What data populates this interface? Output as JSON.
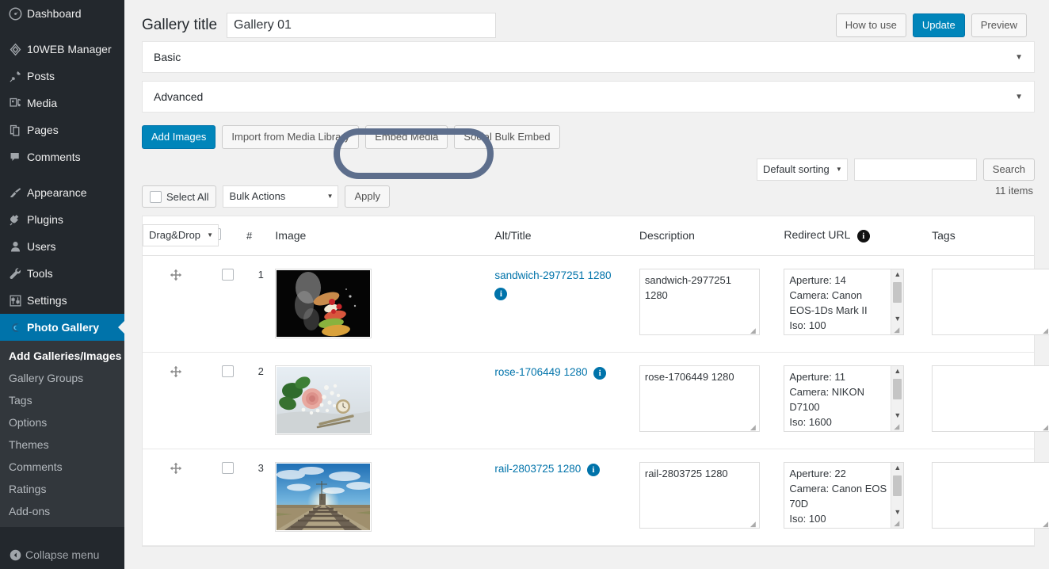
{
  "sidebar": {
    "items": [
      {
        "label": "Dashboard",
        "icon": "dashboard-icon"
      },
      {
        "label": "10WEB Manager",
        "icon": "tenweb-icon"
      },
      {
        "label": "Posts",
        "icon": "pin-icon"
      },
      {
        "label": "Media",
        "icon": "media-icon"
      },
      {
        "label": "Pages",
        "icon": "pages-icon"
      },
      {
        "label": "Comments",
        "icon": "comment-icon"
      },
      {
        "label": "Appearance",
        "icon": "brush-icon"
      },
      {
        "label": "Plugins",
        "icon": "plug-icon"
      },
      {
        "label": "Users",
        "icon": "user-icon"
      },
      {
        "label": "Tools",
        "icon": "wrench-icon"
      },
      {
        "label": "Settings",
        "icon": "sliders-icon"
      },
      {
        "label": "Photo Gallery",
        "icon": "photo-gallery-icon"
      }
    ],
    "submenu": [
      "Add Galleries/Images",
      "Gallery Groups",
      "Tags",
      "Options",
      "Themes",
      "Comments",
      "Ratings",
      "Add-ons"
    ],
    "collapse_label": "Collapse menu",
    "active_item": "Photo Gallery",
    "current_submenu": "Add Galleries/Images",
    "active_color": "#0073aa"
  },
  "header": {
    "title_label": "Gallery title",
    "title_value": "Gallery 01",
    "title_placeholder": "Gallery title",
    "how_to_use": "How to use",
    "update": "Update",
    "preview": "Preview"
  },
  "panels": [
    {
      "label": "Basic",
      "caret": "▼"
    },
    {
      "label": "Advanced",
      "caret": "▼"
    }
  ],
  "action_buttons": [
    "Add Images",
    "Import from Media Library",
    "Embed Media",
    "Social Bulk Embed"
  ],
  "annotation": {
    "target": "Import from Media Library",
    "shape": "rounded-rectangle-outline",
    "color": "#5d6e8c"
  },
  "tools": {
    "sorting_value": "Default sorting",
    "search_value": "",
    "search_placeholder": "",
    "search_button": "Search",
    "item_count": "11 items",
    "select_all": "Select All",
    "bulk_actions": "Bulk Actions",
    "apply": "Apply"
  },
  "table": {
    "headers": {
      "drag": "Drag&Drop",
      "num": "#",
      "image": "Image",
      "alt_title": "Alt/Title",
      "description": "Description",
      "redirect_url": "Redirect URL",
      "redirect_info_icon": "info-icon",
      "tags": "Tags"
    },
    "rows": [
      {
        "num": "1",
        "drag_icon": "move-icon",
        "name": "sandwich-2977251 1280",
        "info_icon": "info-icon",
        "alt_value": "sandwich-2977251 1280",
        "description": "Aperture: 14\nCamera: Canon EOS-1Ds Mark II\nIso: 100",
        "redirect_url": "",
        "tags": "",
        "thumb": "sandwich-photo"
      },
      {
        "num": "2",
        "drag_icon": "move-icon",
        "name": "rose-1706449 1280",
        "info_icon": "info-icon",
        "alt_value": "rose-1706449 1280",
        "description": "Aperture: 11\nCamera: NIKON D7100\nIso: 1600",
        "redirect_url": "",
        "tags": "",
        "thumb": "rose-photo"
      },
      {
        "num": "3",
        "drag_icon": "move-icon",
        "name": "rail-2803725 1280",
        "info_icon": "info-icon",
        "alt_value": "rail-2803725 1280",
        "description": "Aperture: 22\nCamera: Canon EOS 70D\nIso: 100",
        "redirect_url": "",
        "tags": "",
        "thumb": "rail-photo"
      }
    ]
  }
}
